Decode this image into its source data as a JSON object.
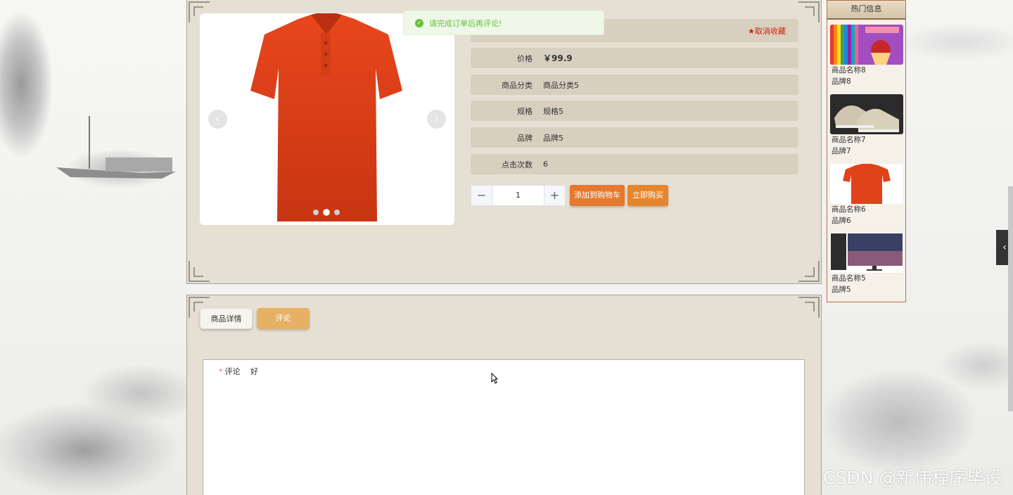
{
  "toast": {
    "message": "请完成订单后再评论!",
    "icon": "success-check-icon"
  },
  "product": {
    "favorite_label": "★取消收藏",
    "fields": [
      {
        "label": "价格",
        "value": "￥99.9"
      },
      {
        "label": "商品分类",
        "value": "商品分类5"
      },
      {
        "label": "规格",
        "value": "规格5"
      },
      {
        "label": "品牌",
        "value": "品牌5"
      },
      {
        "label": "点击次数",
        "value": "6"
      }
    ],
    "quantity": "1",
    "add_to_cart": "添加到购物车",
    "buy_now": "立即购买",
    "carousel": {
      "slides": 3,
      "active": 2
    }
  },
  "hot": {
    "title": "热门信息",
    "items": [
      {
        "name": "商品名称8",
        "brand": "品牌8"
      },
      {
        "name": "商品名称7",
        "brand": "品牌7"
      },
      {
        "name": "商品名称6",
        "brand": "品牌6"
      },
      {
        "name": "商品名称5",
        "brand": "品牌5"
      }
    ]
  },
  "tabs": {
    "detail": "商品详情",
    "comment": "评论"
  },
  "comment_form": {
    "label": "评论",
    "value": "好"
  },
  "watermark": "CSDN @新伟程序毕设",
  "colors": {
    "accent_orange": "#e4792f",
    "tab_active": "#e6b065",
    "success": "#67c23a",
    "favorite": "#d81e06"
  }
}
